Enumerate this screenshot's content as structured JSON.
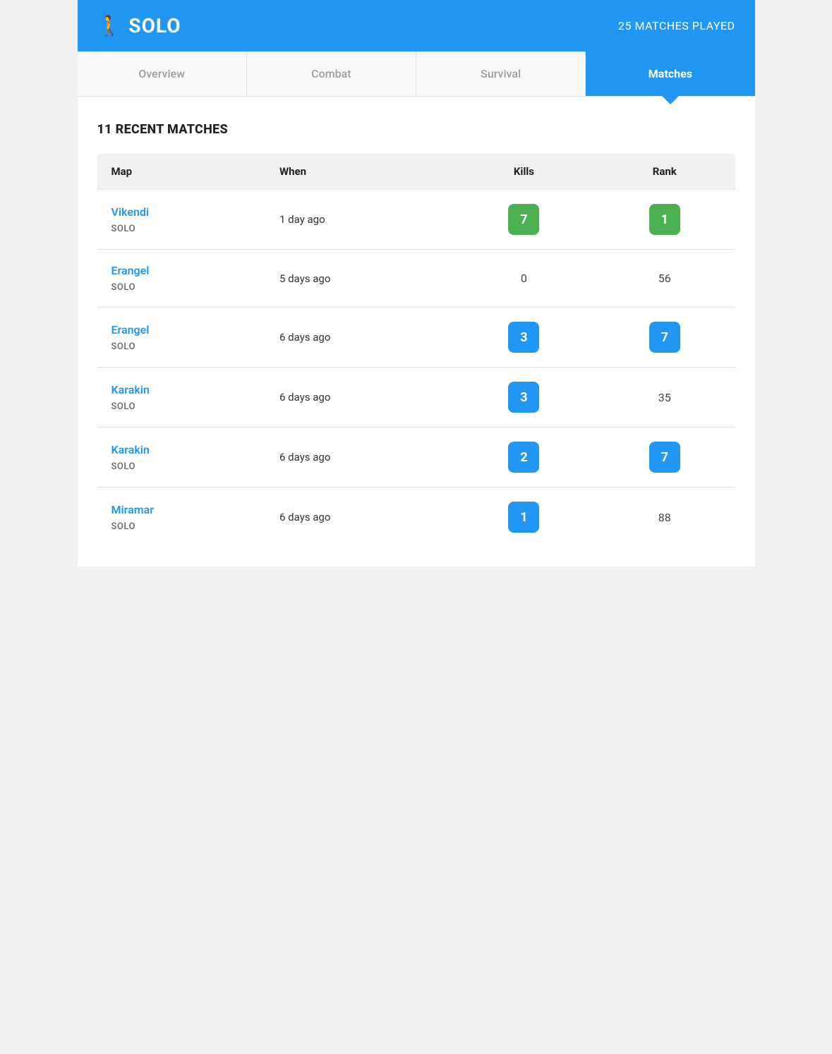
{
  "header": {
    "icon": "🚶",
    "title": "SOLO",
    "matches_played_label": "25 MATCHES PLAYED"
  },
  "tabs": [
    {
      "id": "overview",
      "label": "Overview",
      "active": false
    },
    {
      "id": "combat",
      "label": "Combat",
      "active": false
    },
    {
      "id": "survival",
      "label": "Survival",
      "active": false
    },
    {
      "id": "matches",
      "label": "Matches",
      "active": true
    }
  ],
  "section_title": "11 RECENT MATCHES",
  "table": {
    "columns": {
      "map": "Map",
      "when": "When",
      "kills": "Kills",
      "rank": "Rank"
    },
    "rows": [
      {
        "map": "Vikendi",
        "mode": "SOLO",
        "when": "1 day ago",
        "kills": "7",
        "kills_badge": "green",
        "rank": "1",
        "rank_badge": "green"
      },
      {
        "map": "Erangel",
        "mode": "SOLO",
        "when": "5 days ago",
        "kills": "0",
        "kills_badge": null,
        "rank": "56",
        "rank_badge": null
      },
      {
        "map": "Erangel",
        "mode": "SOLO",
        "when": "6 days ago",
        "kills": "3",
        "kills_badge": "blue",
        "rank": "7",
        "rank_badge": "blue"
      },
      {
        "map": "Karakin",
        "mode": "SOLO",
        "when": "6 days ago",
        "kills": "3",
        "kills_badge": "blue",
        "rank": "35",
        "rank_badge": null
      },
      {
        "map": "Karakin",
        "mode": "SOLO",
        "when": "6 days ago",
        "kills": "2",
        "kills_badge": "blue",
        "rank": "7",
        "rank_badge": "blue"
      },
      {
        "map": "Miramar",
        "mode": "SOLO",
        "when": "6 days ago",
        "kills": "1",
        "kills_badge": "blue",
        "rank": "88",
        "rank_badge": null
      }
    ]
  }
}
